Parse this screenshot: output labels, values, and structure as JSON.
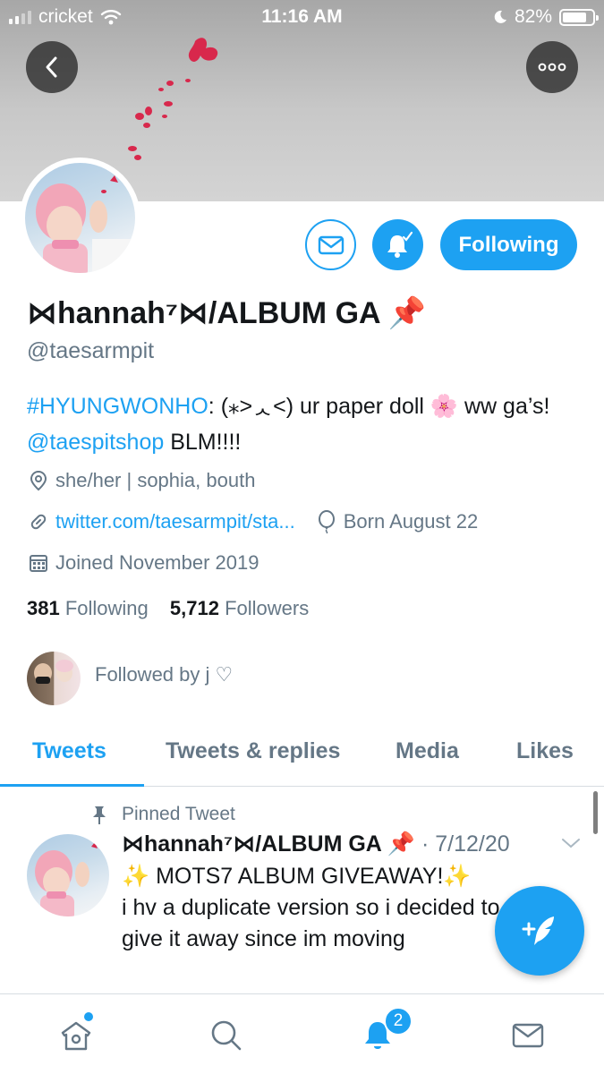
{
  "status_bar": {
    "carrier": "cricket",
    "time": "11:16 AM",
    "battery": "82%",
    "battery_level": 0.82
  },
  "profile": {
    "display_name": "⋈hannah⁷⋈/ALBUM GA 📌",
    "handle": "@taesarmpit",
    "bio_hashtag": "#HYUNGWONHO",
    "bio_text_1": ": (⁎˃ᆺ˂) ur paper doll 🌸 ww ga’s! ",
    "bio_mention": "@taespitshop",
    "bio_text_2": " BLM!!!!",
    "location": "she/her | sophia, bouth",
    "website": "twitter.com/taesarmpit/sta...",
    "birthday": "Born August 22",
    "joined": "Joined November 2019",
    "following_count": "381",
    "following_label": " Following",
    "followers_count": "5,712",
    "followers_label": " Followers",
    "followed_by": "Followed by j ♡",
    "following_button": "Following"
  },
  "tabs": [
    {
      "label": "Tweets",
      "active": true
    },
    {
      "label": "Tweets & replies",
      "active": false
    },
    {
      "label": "Media",
      "active": false
    },
    {
      "label": "Likes",
      "active": false
    }
  ],
  "pinned_tweet": {
    "pinned_label": "Pinned Tweet",
    "author": "⋈hannah⁷⋈/ALBUM GA 📌",
    "date": " · 7/12/20",
    "line1": "✨ MOTS7 ALBUM GIVEAWAY!✨",
    "line2": "i hv a duplicate version so i decided to",
    "line3": "give it away since im moving"
  },
  "bottom_nav": {
    "notifications_badge": "2"
  },
  "colors": {
    "accent": "#1da1f2",
    "secondary_text": "#657786",
    "primary_text": "#14171a"
  },
  "icons": [
    "back-arrow-icon",
    "more-dots-icon",
    "envelope-icon",
    "bell-icon",
    "location-pin-icon",
    "link-icon",
    "balloon-icon",
    "calendar-icon",
    "pin-icon",
    "chevron-down-icon",
    "compose-icon",
    "home-icon",
    "search-icon",
    "notifications-icon",
    "messages-icon"
  ]
}
